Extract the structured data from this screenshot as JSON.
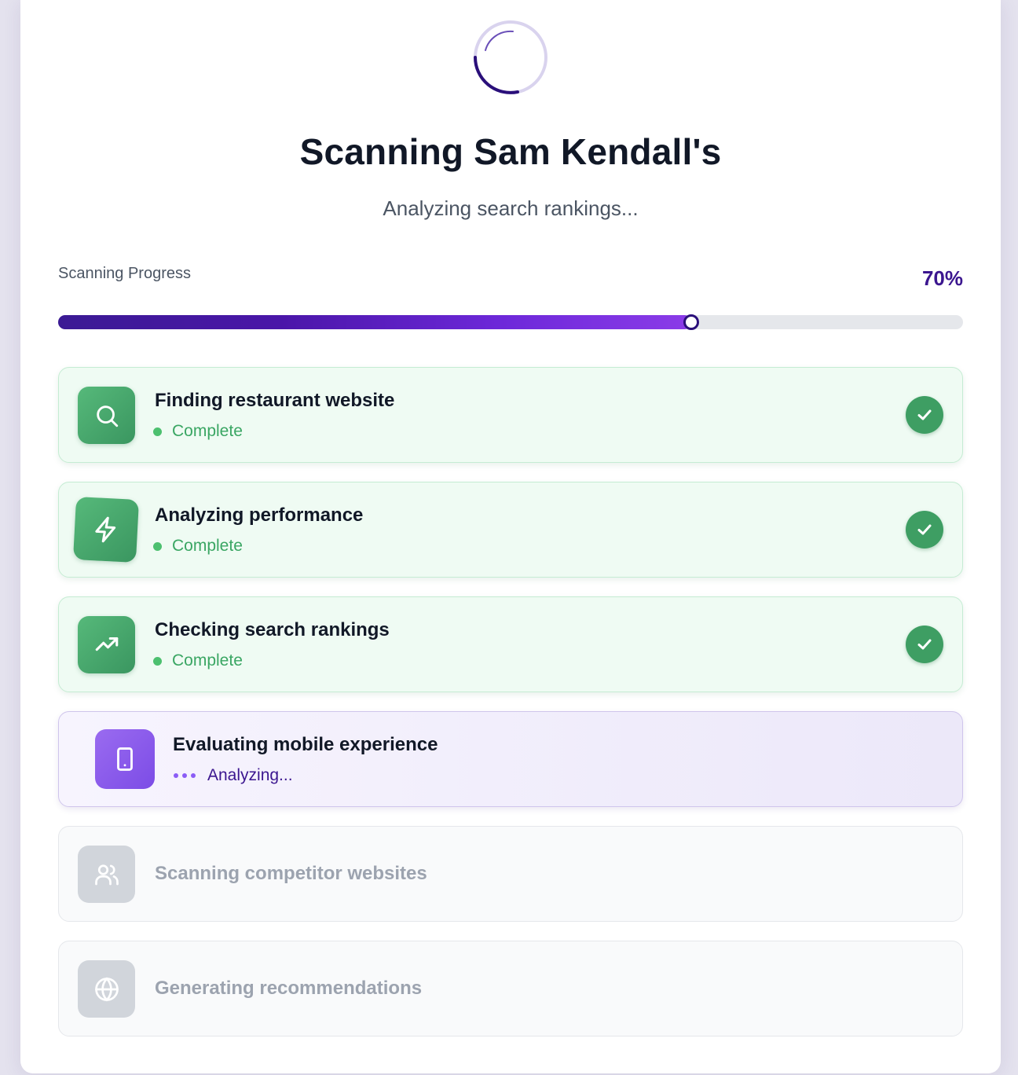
{
  "header": {
    "title": "Scanning Sam Kendall's",
    "subtitle": "Analyzing search rankings..."
  },
  "progress": {
    "label": "Scanning Progress",
    "value_text": "70%",
    "fraction": 0.7
  },
  "steps": [
    {
      "title": "Finding restaurant website",
      "status": "Complete",
      "state": "done",
      "icon": "search-icon"
    },
    {
      "title": "Analyzing performance",
      "status": "Complete",
      "state": "done",
      "icon": "lightning-icon"
    },
    {
      "title": "Checking search rankings",
      "status": "Complete",
      "state": "done",
      "icon": "trending-up-icon"
    },
    {
      "title": "Evaluating mobile experience",
      "status": "Analyzing...",
      "state": "active",
      "icon": "mobile-icon"
    },
    {
      "title": "Scanning competitor websites",
      "status": "",
      "state": "pending",
      "icon": "users-icon"
    },
    {
      "title": "Generating recommendations",
      "status": "",
      "state": "pending",
      "icon": "globe-icon"
    }
  ],
  "colors": {
    "accent": "#3b168f",
    "success": "#3e9e63",
    "active_icon": "#8b5cf6",
    "pending_icon": "#d1d5db"
  }
}
